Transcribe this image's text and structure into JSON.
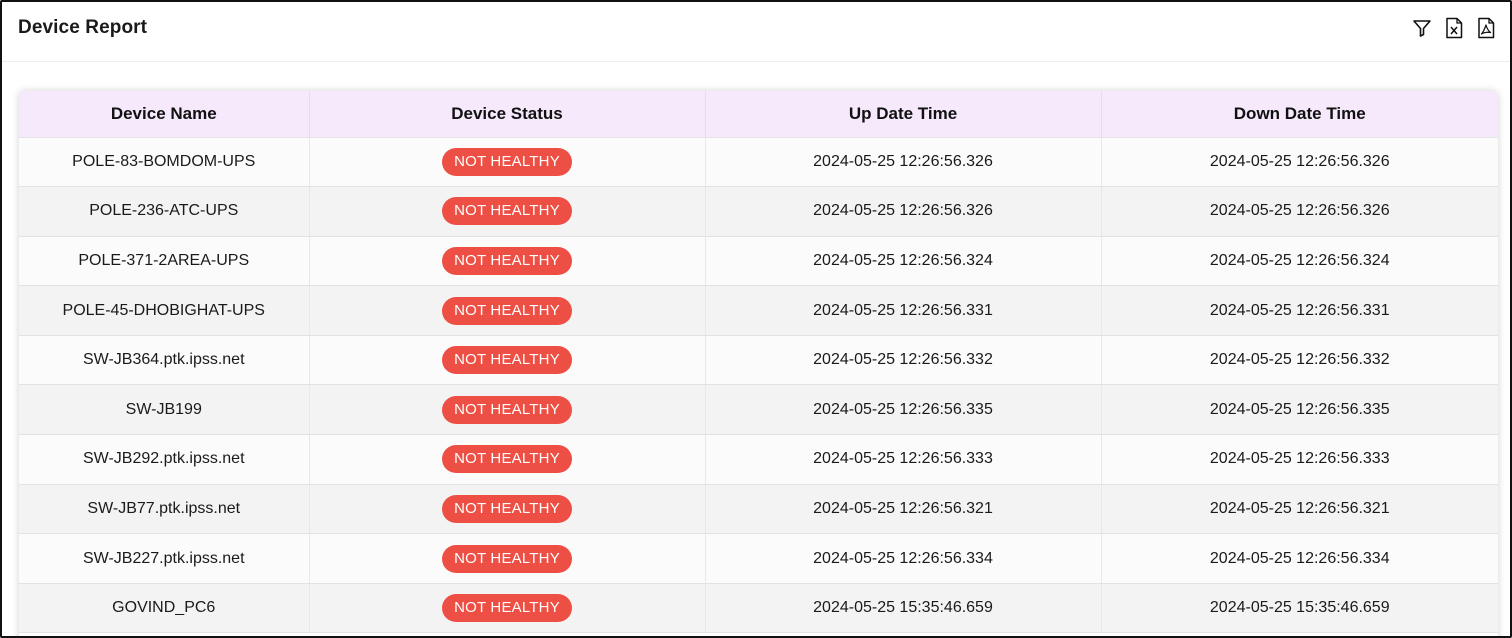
{
  "page": {
    "title": "Device Report"
  },
  "toolbar": {
    "filter_icon": "filter-icon",
    "excel_icon": "excel-export-icon",
    "pdf_icon": "pdf-export-icon"
  },
  "colors": {
    "header_bg": "#f5e9fb",
    "badge_bg": "#ee4f45",
    "badge_text": "#ffffff"
  },
  "table": {
    "columns": [
      "Device Name",
      "Device Status",
      "Up Date Time",
      "Down Date Time"
    ],
    "rows": [
      {
        "device_name": "POLE-83-BOMDOM-UPS",
        "status": "NOT HEALTHY",
        "up": "2024-05-25 12:26:56.326",
        "down": "2024-05-25 12:26:56.326"
      },
      {
        "device_name": "POLE-236-ATC-UPS",
        "status": "NOT HEALTHY",
        "up": "2024-05-25 12:26:56.326",
        "down": "2024-05-25 12:26:56.326"
      },
      {
        "device_name": "POLE-371-2AREA-UPS",
        "status": "NOT HEALTHY",
        "up": "2024-05-25 12:26:56.324",
        "down": "2024-05-25 12:26:56.324"
      },
      {
        "device_name": "POLE-45-DHOBIGHAT-UPS",
        "status": "NOT HEALTHY",
        "up": "2024-05-25 12:26:56.331",
        "down": "2024-05-25 12:26:56.331"
      },
      {
        "device_name": "SW-JB364.ptk.ipss.net",
        "status": "NOT HEALTHY",
        "up": "2024-05-25 12:26:56.332",
        "down": "2024-05-25 12:26:56.332"
      },
      {
        "device_name": "SW-JB199",
        "status": "NOT HEALTHY",
        "up": "2024-05-25 12:26:56.335",
        "down": "2024-05-25 12:26:56.335"
      },
      {
        "device_name": "SW-JB292.ptk.ipss.net",
        "status": "NOT HEALTHY",
        "up": "2024-05-25 12:26:56.333",
        "down": "2024-05-25 12:26:56.333"
      },
      {
        "device_name": "SW-JB77.ptk.ipss.net",
        "status": "NOT HEALTHY",
        "up": "2024-05-25 12:26:56.321",
        "down": "2024-05-25 12:26:56.321"
      },
      {
        "device_name": "SW-JB227.ptk.ipss.net",
        "status": "NOT HEALTHY",
        "up": "2024-05-25 12:26:56.334",
        "down": "2024-05-25 12:26:56.334"
      },
      {
        "device_name": "GOVIND_PC6",
        "status": "NOT HEALTHY",
        "up": "2024-05-25 15:35:46.659",
        "down": "2024-05-25 15:35:46.659"
      }
    ]
  }
}
